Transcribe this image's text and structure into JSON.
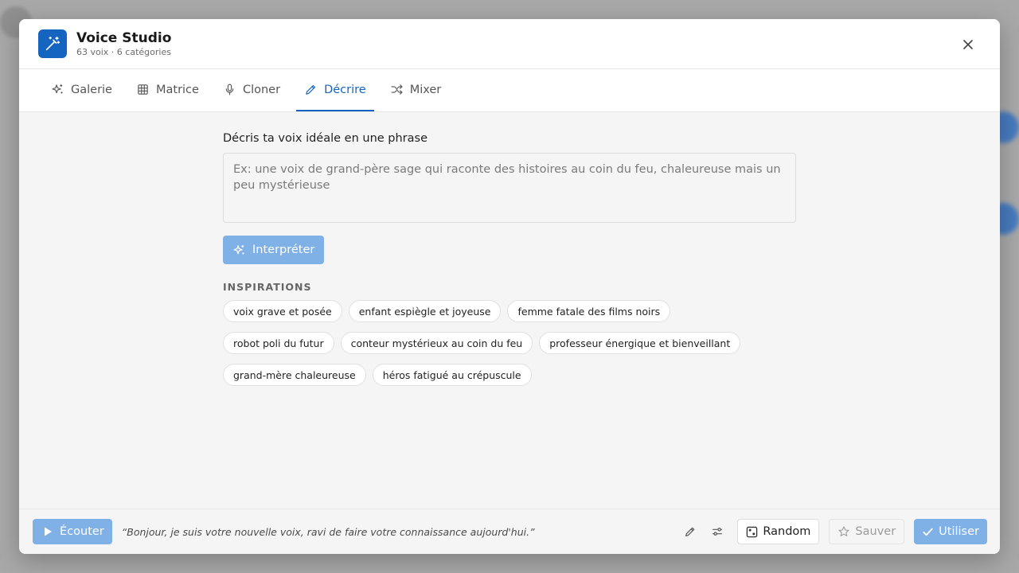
{
  "header": {
    "title": "Voice Studio",
    "subtitle": "63 voix · 6 catégories"
  },
  "tabs": [
    {
      "label": "Galerie",
      "icon": "sparkles-icon"
    },
    {
      "label": "Matrice",
      "icon": "grid-icon"
    },
    {
      "label": "Cloner",
      "icon": "microphone-icon"
    },
    {
      "label": "Décrire",
      "icon": "pencil-icon",
      "active": true
    },
    {
      "label": "Mixer",
      "icon": "shuffle-icon"
    }
  ],
  "describe": {
    "prompt_label": "Décris ta voix idéale en une phrase",
    "placeholder": "Ex: une voix de grand-père sage qui raconte des histoires au coin du feu, chaleureuse mais un peu mystérieuse",
    "value": "",
    "interpret_label": "Interpréter",
    "inspirations_title": "INSPIRATIONS",
    "inspirations": [
      "voix grave et posée",
      "enfant espiègle et joyeuse",
      "femme fatale des films noirs",
      "robot poli du futur",
      "conteur mystérieux au coin du feu",
      "professeur énergique et bienveillant",
      "grand-mère chaleureuse",
      "héros fatigué au crépuscule"
    ]
  },
  "footer": {
    "listen_label": "Écouter",
    "sample_text": "“Bonjour, je suis votre nouvelle voix, ravi de faire votre connaissance aujourd'hui.”",
    "random_label": "Random",
    "save_label": "Sauver",
    "use_label": "Utiliser"
  },
  "colors": {
    "accent": "#1565c0",
    "accent_disabled": "#7fb0e6"
  }
}
